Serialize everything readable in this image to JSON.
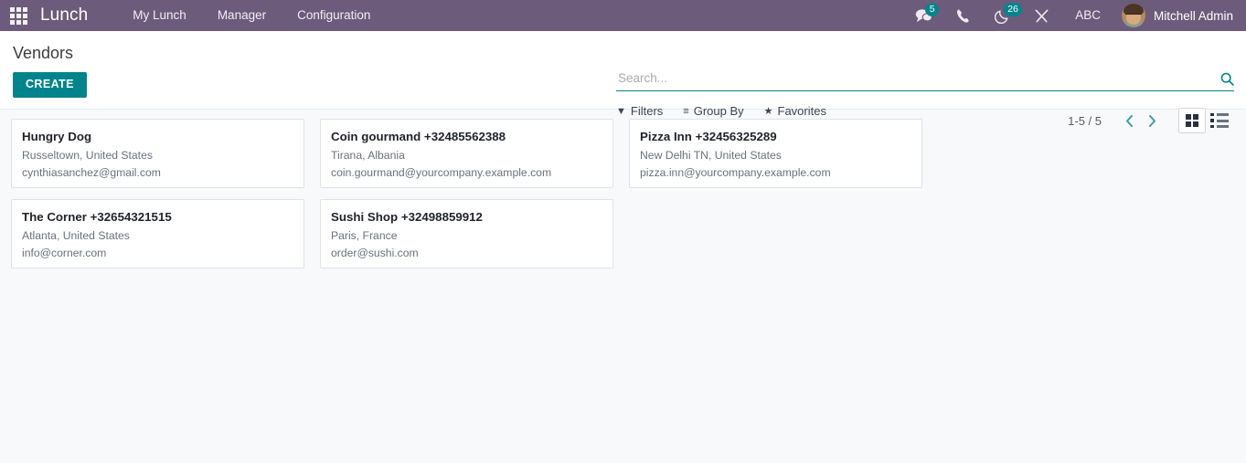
{
  "navbar": {
    "apps_icon": "apps-grid-icon",
    "brand": "Lunch",
    "menu": [
      {
        "label": "My Lunch"
      },
      {
        "label": "Manager"
      },
      {
        "label": "Configuration"
      }
    ],
    "systray": {
      "messages_icon": "chat-bubble-icon",
      "messages_count": "5",
      "phone_icon": "phone-icon",
      "activities_icon": "crescent-moon-icon",
      "activities_count": "26",
      "tools_icon": "wrench-screwdriver-icon",
      "abc_label": "ABC",
      "avatar_icon": "user-avatar",
      "username": "Mitchell Admin"
    },
    "colors": {
      "background": "#6d5b7b",
      "badge": "#00848c"
    }
  },
  "control_panel": {
    "breadcrumb": "Vendors",
    "create_label": "CREATE",
    "search": {
      "placeholder": "Search...",
      "value": "",
      "search_icon": "magnifier-icon"
    },
    "filter_buttons": [
      {
        "icon": "funnel-icon",
        "glyph": "▼",
        "label": "Filters"
      },
      {
        "icon": "hamburger-lines-icon",
        "glyph": "≡",
        "label": "Group By"
      },
      {
        "icon": "star-icon",
        "glyph": "★",
        "label": "Favorites"
      }
    ],
    "pager": {
      "range": "1-5 / 5",
      "previous_icon": "chevron-left-icon",
      "next_icon": "chevron-right-icon"
    },
    "view_switcher": [
      {
        "name": "kanban",
        "icon": "kanban-view-icon",
        "active": true
      },
      {
        "name": "list",
        "icon": "list-view-icon",
        "active": false
      }
    ],
    "colors": {
      "accent": "#00848c"
    }
  },
  "kanban": {
    "cards": [
      {
        "title": "Hungry Dog",
        "location": "Russeltown, United States",
        "email": "cynthiasanchez@gmail.com"
      },
      {
        "title": "Coin gourmand +32485562388",
        "location": "Tirana, Albania",
        "email": "coin.gourmand@yourcompany.example.com"
      },
      {
        "title": "Pizza Inn +32456325289",
        "location": "New Delhi TN, United States",
        "email": "pizza.inn@yourcompany.example.com"
      },
      {
        "title": "The Corner +32654321515",
        "location": "Atlanta, United States",
        "email": "info@corner.com"
      },
      {
        "title": "Sushi Shop +32498859912",
        "location": "Paris, France",
        "email": "order@sushi.com"
      }
    ]
  }
}
